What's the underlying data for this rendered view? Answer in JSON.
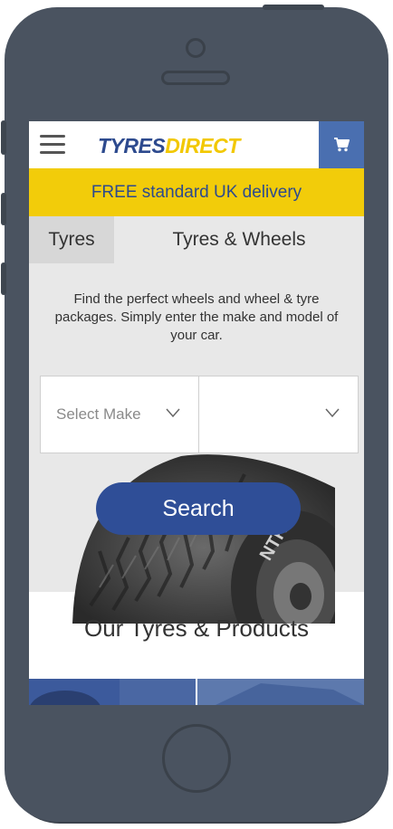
{
  "colors": {
    "brand_blue": "#2d4a8e",
    "brand_yellow": "#f2c800",
    "banner_bg": "#f2cc0a",
    "cart_bg": "#4a6fb0",
    "search_bg": "#2f4e97",
    "phone_body": "#4a5360"
  },
  "header": {
    "logo_part1": "TYRES",
    "logo_part2": "DIRECT",
    "menu_icon": "hamburger-menu-icon",
    "cart_icon": "shopping-cart-icon"
  },
  "banner": {
    "text": "FREE standard UK delivery"
  },
  "tabs": [
    {
      "label": "Tyres",
      "active": true
    },
    {
      "label": "Tyres & Wheels",
      "active": false
    }
  ],
  "intro": {
    "text": "Find the perfect wheels and wheel & tyre packages. Simply enter the make and model of your car."
  },
  "selects": {
    "make": {
      "value": "Select Make",
      "icon": "chevron-down-icon"
    },
    "model": {
      "value": "",
      "icon": "chevron-down-icon"
    }
  },
  "search": {
    "label": "Search"
  },
  "products_section": {
    "title": "Our Tyres & Products"
  }
}
